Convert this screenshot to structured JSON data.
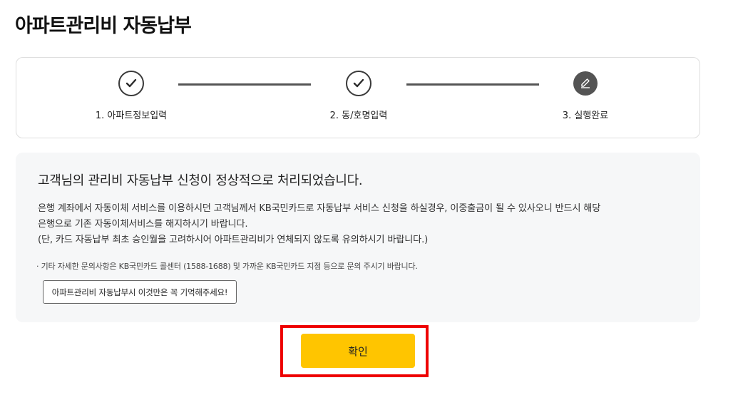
{
  "page": {
    "title": "아파트관리비 자동납부"
  },
  "stepper": {
    "steps": [
      {
        "number_label": "1. 아파트정보입력",
        "status": "done",
        "icon": "check-icon"
      },
      {
        "number_label": "2. 동/호명입력",
        "status": "done",
        "icon": "check-icon"
      },
      {
        "number_label": "3. 실행완료",
        "status": "current",
        "icon": "pencil-icon"
      }
    ]
  },
  "info": {
    "heading": "고객님의 관리비 자동납부 신청이 정상적으로 처리되었습니다.",
    "line1": "은행 계좌에서 자동이체 서비스를 이용하시던 고객님께서 KB국민카드로 자동납부 서비스 신청을 하실경우, 이중출금이 될 수 있사오니 반드시 해당",
    "line2": "은행으로 기존 자동이체서비스를 해지하시기 바랍니다.",
    "line3": "(단, 카드 자동납부 최초 승인월을 고려하시어 아파트관리비가 연체되지 않도록 유의하시기 바랍니다.)",
    "note": "· 기타 자세한 문의사항은 KB국민카드 콜센터 (1588-1688) 및 가까운 KB국민카드 지점 등으로 문의 주시기 바랍니다.",
    "remember_button_label": "아파트관리비 자동납부시 이것만은 꼭 기억해주세요!"
  },
  "actions": {
    "confirm_label": "확인"
  },
  "colors": {
    "accent_button": "#ffc500",
    "highlight_frame": "#ee0000",
    "step_dark": "#545454"
  }
}
